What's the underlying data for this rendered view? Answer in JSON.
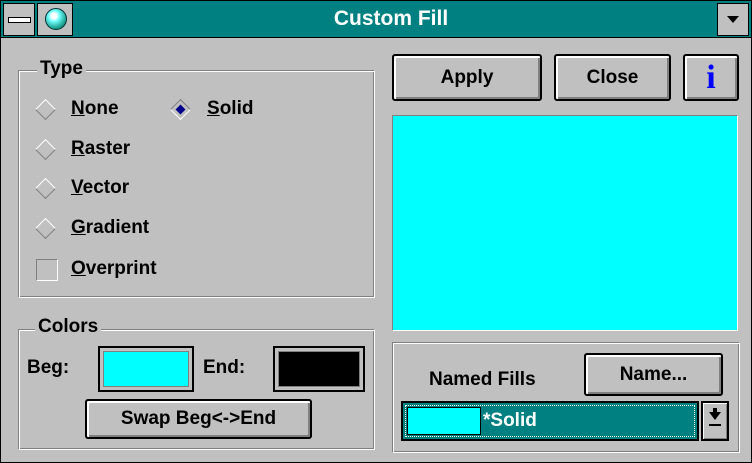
{
  "window": {
    "title": "Custom Fill"
  },
  "type_group": {
    "legend": "Type",
    "options": [
      {
        "label": "None",
        "key": "N",
        "rest": "one",
        "selected": false
      },
      {
        "label": "Solid",
        "key": "S",
        "rest": "olid",
        "selected": true
      },
      {
        "label": "Raster",
        "key": "R",
        "rest": "aster",
        "selected": false
      },
      {
        "label": "Vector",
        "key": "V",
        "rest": "ector",
        "selected": false
      },
      {
        "label": "Gradient",
        "key": "G",
        "rest": "radient",
        "selected": false
      }
    ],
    "overprint": {
      "label": "Overprint",
      "key": "O",
      "rest": "verprint",
      "checked": false
    }
  },
  "buttons": {
    "apply": "Apply",
    "close": "Close",
    "info": "i"
  },
  "colors_group": {
    "legend": "Colors",
    "beg_label": "Beg:",
    "end_label": "End:",
    "beg_color": "#00ffff",
    "end_color": "#000000",
    "swap_label": "Swap Beg<->End"
  },
  "preview": {
    "color": "#00ffff"
  },
  "named_fills": {
    "label": "Named Fills",
    "name_button": "Name...",
    "selected": "*Solid",
    "selected_color": "#00ffff",
    "highlight_color": "#008080"
  }
}
